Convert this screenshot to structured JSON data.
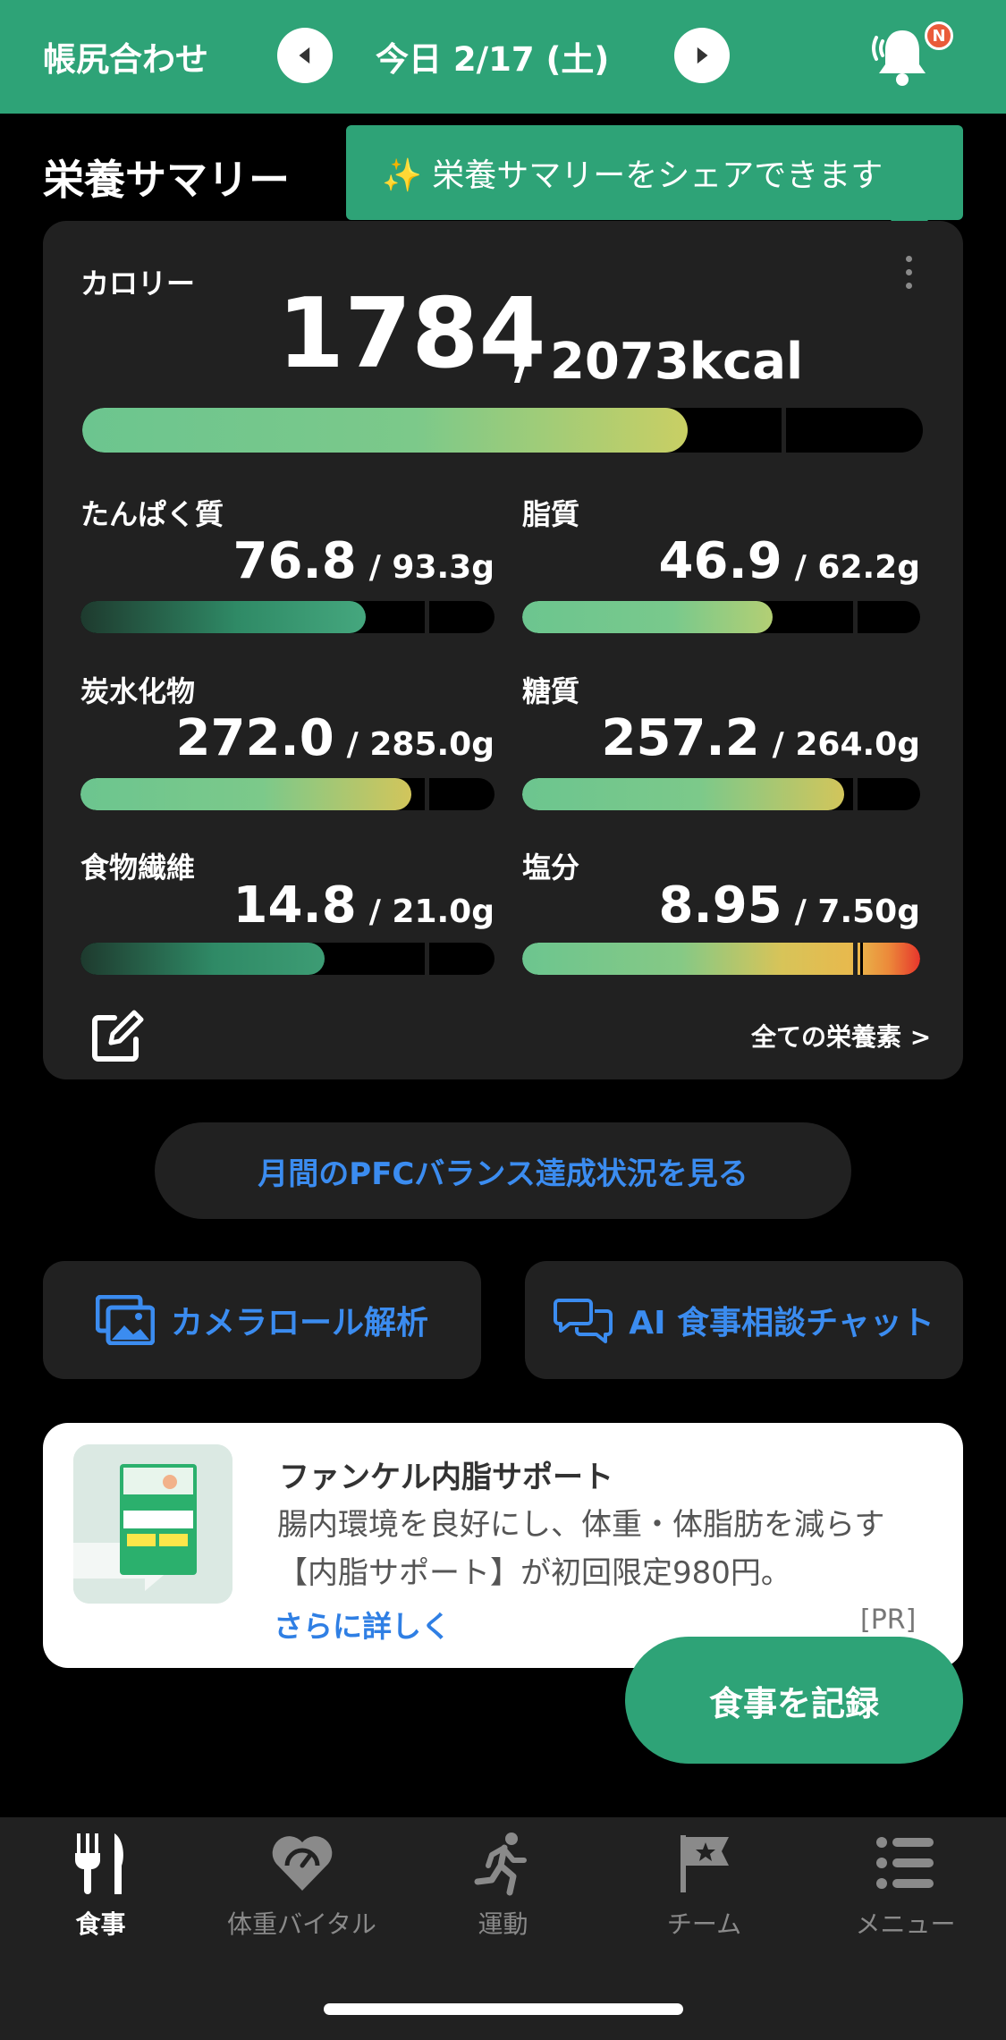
{
  "header": {
    "title": "帳尻合わせ",
    "date": "今日 2/17 (土)",
    "badge": "N"
  },
  "summary": {
    "title": "栄養サマリー",
    "tooltip": "✨ 栄養サマリーをシェアできます",
    "calorie": {
      "label": "カロリー",
      "value": "1784",
      "target": "/ 2073kcal",
      "progress": 0.72
    },
    "nutrients": [
      {
        "label": "たんぱく質",
        "value": "76.8",
        "target": "/ 93.3g",
        "progress": 0.69
      },
      {
        "label": "脂質",
        "value": "46.9",
        "target": "/ 62.2g",
        "progress": 0.63
      },
      {
        "label": "炭水化物",
        "value": "272.0",
        "target": "/ 285.0g",
        "progress": 0.8
      },
      {
        "label": "糖質",
        "value": "257.2",
        "target": "/ 264.0g",
        "progress": 0.81
      },
      {
        "label": "食物繊維",
        "value": "14.8",
        "target": "/ 21.0g",
        "progress": 0.59
      },
      {
        "label": "塩分",
        "value": "8.95",
        "target": "/ 7.50g",
        "progress": 1.0
      }
    ],
    "all_link": "全ての栄養素 >"
  },
  "buttons": {
    "pfc": "月間のPFCバランス達成状況を見る",
    "camera": "カメラロール解析",
    "ai_chat": "AI 食事相談チャット"
  },
  "ad": {
    "title": "ファンケル内脂サポート",
    "desc": "腸内環境を良好にし、体重・体脂肪を減らす【内脂サポート】が初回限定980円。",
    "more": "さらに詳しく",
    "pr": "[PR]"
  },
  "fab": "食事を記録",
  "tabs": [
    {
      "label": "食事",
      "icon": "fork-knife-icon",
      "active": true
    },
    {
      "label": "体重バイタル",
      "icon": "heart-gauge-icon"
    },
    {
      "label": "運動",
      "icon": "runner-icon"
    },
    {
      "label": "チーム",
      "icon": "flag-star-icon"
    },
    {
      "label": "メニュー",
      "icon": "list-icon"
    }
  ],
  "colors": {
    "brand": "#2ea377",
    "link": "#3b8cf0",
    "card": "#212121"
  }
}
